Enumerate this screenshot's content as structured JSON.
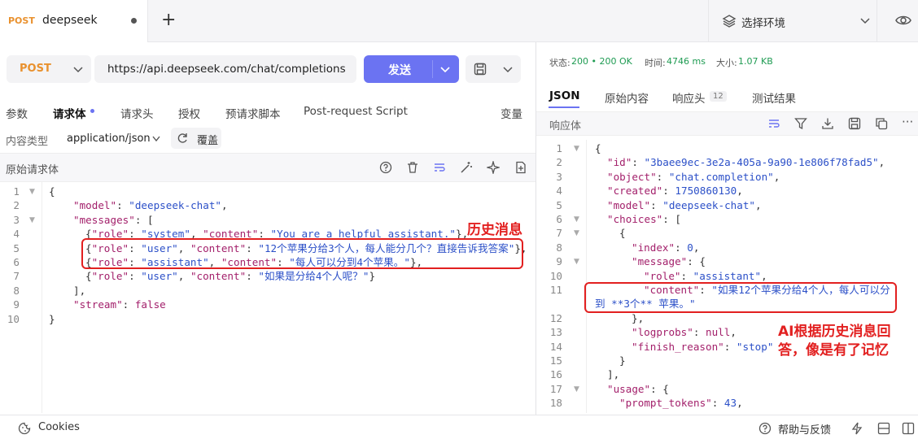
{
  "tab": {
    "method": "POST",
    "name": "deepseek"
  },
  "env": {
    "label": "选择环境"
  },
  "request": {
    "method": "POST",
    "url": "https://api.deepseek.com/chat/completions",
    "send_label": "发送"
  },
  "req_tabs": [
    "参数",
    "请求体",
    "请求头",
    "授权",
    "预请求脚本",
    "Post-request Script",
    "变量"
  ],
  "content_type": {
    "label": "内容类型",
    "value": "application/json",
    "override": "覆盖"
  },
  "raw_label": "原始请求体",
  "request_body": [
    [
      [
        "p",
        "{"
      ]
    ],
    [
      [
        "k",
        "\"model\""
      ],
      [
        "p",
        ": "
      ],
      [
        "s",
        "\"deepseek-chat\""
      ],
      [
        "p",
        ","
      ]
    ],
    [
      [
        "k",
        "\"messages\""
      ],
      [
        "p",
        ": ["
      ]
    ],
    [
      [
        "p",
        "{"
      ],
      [
        "k",
        "\"role\""
      ],
      [
        "p",
        ": "
      ],
      [
        "s",
        "\"system\""
      ],
      [
        "p",
        ", "
      ],
      [
        "k",
        "\"content\""
      ],
      [
        "p",
        ": "
      ],
      [
        "s",
        "\"You are a helpful assistant.\""
      ],
      [
        "p",
        "},"
      ]
    ],
    [
      [
        "p",
        "{"
      ],
      [
        "k",
        "\"role\""
      ],
      [
        "p",
        ": "
      ],
      [
        "s",
        "\"user\""
      ],
      [
        "p",
        ", "
      ],
      [
        "k",
        "\"content\""
      ],
      [
        "p",
        ": "
      ],
      [
        "s",
        "\"12个苹果分给3个人，每人能分几个？直接告诉我答案\""
      ],
      [
        "p",
        "},"
      ]
    ],
    [
      [
        "p",
        "{"
      ],
      [
        "k",
        "\"role\""
      ],
      [
        "p",
        ": "
      ],
      [
        "s",
        "\"assistant\""
      ],
      [
        "p",
        ", "
      ],
      [
        "k",
        "\"content\""
      ],
      [
        "p",
        ": "
      ],
      [
        "s",
        "\"每人可以分到4个苹果。\""
      ],
      [
        "p",
        "},"
      ]
    ],
    [
      [
        "p",
        "{"
      ],
      [
        "k",
        "\"role\""
      ],
      [
        "p",
        ": "
      ],
      [
        "s",
        "\"user\""
      ],
      [
        "p",
        ", "
      ],
      [
        "k",
        "\"content\""
      ],
      [
        "p",
        ": "
      ],
      [
        "s",
        "\"如果是分给4个人呢？\""
      ],
      [
        "p",
        "}"
      ]
    ],
    [
      [
        "p",
        "],"
      ]
    ],
    [
      [
        "k",
        "\"stream\""
      ],
      [
        "p",
        ": "
      ],
      [
        "b",
        "false"
      ]
    ],
    [
      [
        "p",
        "}"
      ]
    ]
  ],
  "status": {
    "status_label": "状态:",
    "status_value": "200 • 200 OK",
    "time_label": "时间:",
    "time_value": "4746 ms",
    "size_label": "大小:",
    "size_value": "1.07 KB"
  },
  "resp_tabs": [
    "JSON",
    "原始内容",
    "响应头",
    "测试结果"
  ],
  "resp_header_count": "12",
  "resp_body_label": "响应体",
  "response_body": [
    [
      [
        "p",
        "{"
      ]
    ],
    [
      [
        "k",
        "\"id\""
      ],
      [
        "p",
        ": "
      ],
      [
        "s",
        "\"3baee9ec-3e2a-405a-9a90-1e806f78fad5\""
      ],
      [
        "p",
        ","
      ]
    ],
    [
      [
        "k",
        "\"object\""
      ],
      [
        "p",
        ": "
      ],
      [
        "s",
        "\"chat.completion\""
      ],
      [
        "p",
        ","
      ]
    ],
    [
      [
        "k",
        "\"created\""
      ],
      [
        "p",
        ": "
      ],
      [
        "s",
        "1750860130"
      ],
      [
        "p",
        ","
      ]
    ],
    [
      [
        "k",
        "\"model\""
      ],
      [
        "p",
        ": "
      ],
      [
        "s",
        "\"deepseek-chat\""
      ],
      [
        "p",
        ","
      ]
    ],
    [
      [
        "k",
        "\"choices\""
      ],
      [
        "p",
        ": ["
      ]
    ],
    [
      [
        "p",
        "{"
      ]
    ],
    [
      [
        "k",
        "\"index\""
      ],
      [
        "p",
        ": "
      ],
      [
        "s",
        "0"
      ],
      [
        "p",
        ","
      ]
    ],
    [
      [
        "k",
        "\"message\""
      ],
      [
        "p",
        ": {"
      ]
    ],
    [
      [
        "k",
        "\"role\""
      ],
      [
        "p",
        ": "
      ],
      [
        "s",
        "\"assistant\""
      ],
      [
        "p",
        ","
      ]
    ],
    [
      [
        "k",
        "\"content\""
      ],
      [
        "p",
        ": "
      ],
      [
        "s",
        "\"如果12个苹果分给4个人，每人可以分"
      ]
    ],
    [
      [
        "s",
        "到 **3个** 苹果。\""
      ]
    ],
    [
      [
        "p",
        "},"
      ]
    ],
    [
      [
        "k",
        "\"logprobs\""
      ],
      [
        "p",
        ": "
      ],
      [
        "b",
        "null"
      ],
      [
        "p",
        ","
      ]
    ],
    [
      [
        "k",
        "\"finish_reason\""
      ],
      [
        "p",
        ": "
      ],
      [
        "s",
        "\"stop\""
      ]
    ],
    [
      [
        "p",
        "}"
      ]
    ],
    [
      [
        "p",
        "],"
      ]
    ],
    [
      [
        "k",
        "\"usage\""
      ],
      [
        "p",
        ": {"
      ]
    ],
    [
      [
        "k",
        "\"prompt_tokens\""
      ],
      [
        "p",
        ": "
      ],
      [
        "s",
        "43"
      ],
      [
        "p",
        ","
      ]
    ]
  ],
  "annotations": {
    "history": "历史消息",
    "ai_line1": "AI根据历史消息回",
    "ai_line2": "答，像是有了记忆"
  },
  "bottom": {
    "cookies": "Cookies",
    "help": "帮助与反馈"
  }
}
